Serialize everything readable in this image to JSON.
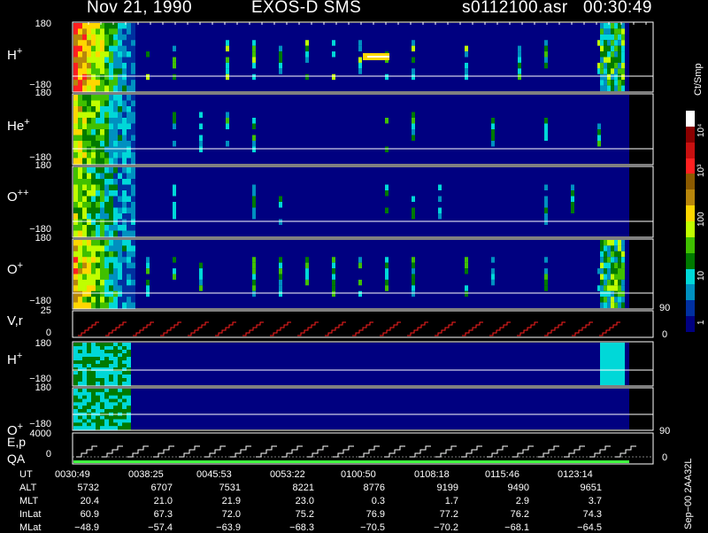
{
  "header": {
    "date": "Nov 21, 1990",
    "instrument": "EXOS-D SMS",
    "filename": "s0112100.asr",
    "time": "00:30:49"
  },
  "panels": [
    {
      "label": "H",
      "sup": "+",
      "top": "180",
      "bottom": "−180"
    },
    {
      "label": "He",
      "sup": "+",
      "top": "180",
      "bottom": "−180"
    },
    {
      "label": "O",
      "sup": "++",
      "top": "180",
      "bottom": "−180"
    },
    {
      "label": "O",
      "sup": "+",
      "top": "180",
      "bottom": "−180"
    },
    {
      "label": "V,r",
      "sup": "",
      "top": "25",
      "bottom": "0",
      "right": "90",
      "rightbottom": "0"
    },
    {
      "label": "H",
      "sup": "+",
      "top": "180",
      "bottom": "−180"
    },
    {
      "label": "O",
      "sup": "+",
      "top": "180",
      "bottom": "−180"
    },
    {
      "label": "E,p",
      "label2": "QA",
      "sup": "",
      "top": "4000",
      "bottom": "0",
      "right": "90",
      "rightbottom": "0"
    }
  ],
  "colorbar": {
    "unit": "Ct/Smp",
    "labels": [
      "10⁴",
      "10³",
      "100",
      "10",
      "1"
    ],
    "colors": [
      "#ffffff",
      "#8b0000",
      "#c81010",
      "#ff2020",
      "#8b5a00",
      "#b8860b",
      "#ffd700",
      "#c0ff00",
      "#40c000",
      "#007a00",
      "#00d8d8",
      "#0090c0",
      "#0030a0",
      "#000080"
    ]
  },
  "footer": {
    "rows": [
      {
        "name": "UT",
        "values": [
          "0030:49",
          "0038:25",
          "0045:53",
          "0053:22",
          "0100:50",
          "0108:18",
          "0115:46",
          "0123:14"
        ]
      },
      {
        "name": "ALT",
        "values": [
          "5732",
          "6707",
          "7531",
          "8221",
          "8776",
          "9199",
          "9490",
          "9651"
        ]
      },
      {
        "name": "MLT",
        "values": [
          "20.4",
          "21.0",
          "21.9",
          "23.0",
          "0.3",
          "1.7",
          "2.9",
          "3.7"
        ]
      },
      {
        "name": "InLat",
        "values": [
          "60.9",
          "67.3",
          "72.0",
          "75.2",
          "76.9",
          "77.2",
          "76.2",
          "74.3"
        ]
      },
      {
        "name": "MLat",
        "values": [
          "−48.9",
          "−57.4",
          "−63.9",
          "−68.3",
          "−70.5",
          "−70.2",
          "−68.1",
          "−64.5"
        ]
      }
    ],
    "version": "Sep−00 2AA32L"
  },
  "chart_data": {
    "type": "heatmap",
    "title": "Nov 21, 1990   EXOS-D SMS",
    "xlabel": "UT",
    "x_ticks": [
      "0030:49",
      "0038:25",
      "0045:53",
      "0053:22",
      "0100:50",
      "0108:18",
      "0115:46",
      "0123:14"
    ],
    "series": [
      {
        "name": "H+",
        "ylim": [
          -180,
          180
        ]
      },
      {
        "name": "He+",
        "ylim": [
          -180,
          180
        ]
      },
      {
        "name": "O++",
        "ylim": [
          -180,
          180
        ]
      },
      {
        "name": "O+",
        "ylim": [
          -180,
          180
        ]
      },
      {
        "name": "V,r",
        "ylim": [
          0,
          25
        ]
      },
      {
        "name": "H+",
        "ylim": [
          -180,
          180
        ]
      },
      {
        "name": "O+",
        "ylim": [
          -180,
          180
        ]
      },
      {
        "name": "E,p QA",
        "ylim": [
          0,
          4000
        ]
      }
    ],
    "colorscale": {
      "unit": "Ct/Smp",
      "scale": "log",
      "range": [
        1,
        10000
      ]
    }
  }
}
